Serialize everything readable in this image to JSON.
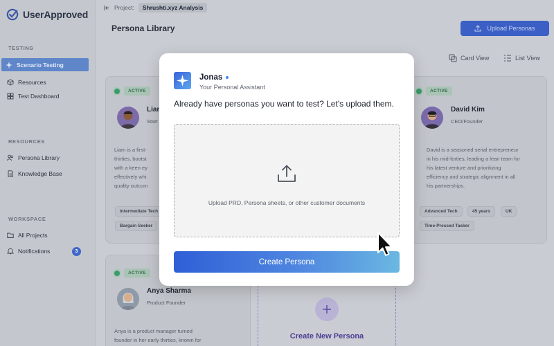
{
  "app": {
    "name": "UserApproved"
  },
  "sidebar": {
    "sections": [
      {
        "title": "TESTING"
      },
      {
        "title": "RESOURCES"
      },
      {
        "title": "WORKSPACE"
      }
    ],
    "items": [
      {
        "label": "Scenario Testing",
        "icon": "sparkle-icon"
      },
      {
        "label": "Resources",
        "icon": "cube-icon"
      },
      {
        "label": "Test Dashboard",
        "icon": "dashboard-icon"
      },
      {
        "label": "Persona Library",
        "icon": "users-icon"
      },
      {
        "label": "Knowledge Base",
        "icon": "document-icon"
      },
      {
        "label": "All Projects",
        "icon": "folder-icon"
      },
      {
        "label": "Notifications",
        "icon": "bell-icon",
        "count": "3"
      }
    ]
  },
  "topbar": {
    "project_label": "Project:",
    "project_name": "Shrushti.xyz Analysis"
  },
  "page": {
    "title": "Persona Library",
    "upload_button": "Upload Personas",
    "views": {
      "card": "Card View",
      "list": "List View"
    }
  },
  "personas": [
    {
      "status": "ACTIVE",
      "name": "Liam",
      "role": "Start",
      "desc": [
        "Liam is a first-",
        "thirties, bootst",
        "with a keen ey",
        "effectively whi",
        "quality outcom"
      ],
      "tags": [
        "Intermediate Tech",
        "Bargain Seeker"
      ]
    },
    {
      "status": "ACTIVE",
      "name": "David Kim",
      "role": "CEO/Founder",
      "desc": [
        "David is a seasoned serial entrepreneur",
        "in his mid-forties, leading a lean team for",
        "his latest venture and prioritizing",
        "efficiency and strategic alignment in all",
        "his partnerships."
      ],
      "tags": [
        "Advanced Tech",
        "45 years",
        "UK",
        "Time-Pressed Tasker"
      ]
    },
    {
      "status": "ACTIVE",
      "name": "Anya Sharma",
      "role": "Product Founder",
      "desc": [
        "Anya is a product manager turned",
        "founder in her early thirties, known for"
      ],
      "tags": []
    }
  ],
  "create_new": {
    "label": "Create New Persona"
  },
  "modal": {
    "assistant_name": "Jonas",
    "assistant_subtitle": "Your Personal Assistant",
    "prompt": "Already have personas you want to test? Let's upload them.",
    "dropzone_text": "Upload PRD, Persona sheets, or other customer documents",
    "create_button": "Create Persona"
  },
  "colors": {
    "accent": "#3b5fc4",
    "active_green": "#3c9b6a",
    "create_purple": "#4c3f95"
  }
}
